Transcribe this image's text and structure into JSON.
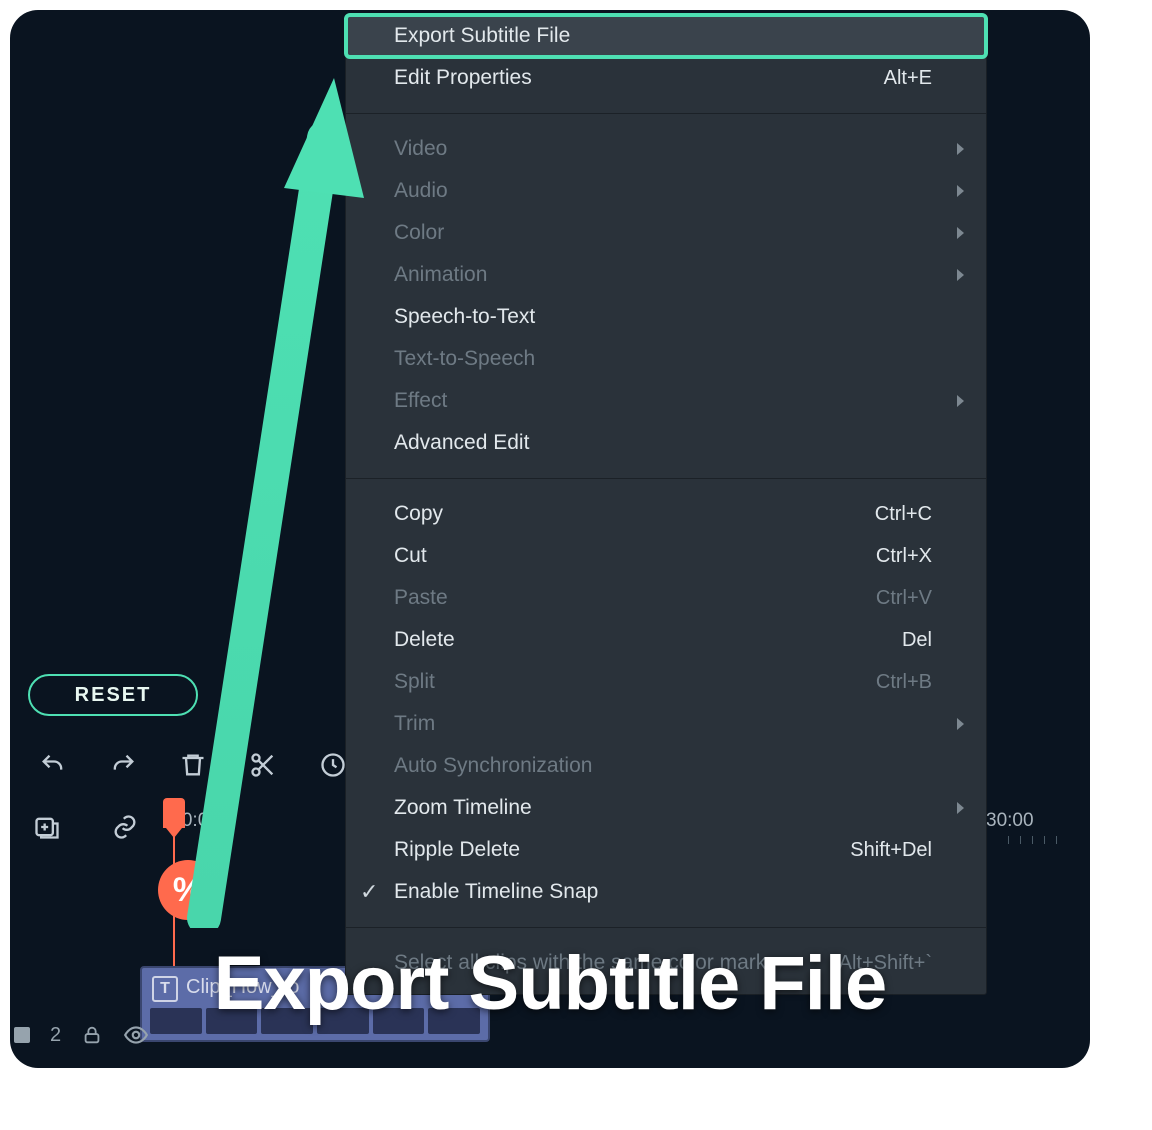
{
  "reset_label": "RESET",
  "ruler": {
    "label_left": ":00:0",
    "label_right": "30:00"
  },
  "clip": {
    "badge": "T",
    "name": "Clip_How_to"
  },
  "bottom_left": {
    "num": "2"
  },
  "caption": "Export Subtitle File",
  "marker_glyph": "%",
  "menu": {
    "groups": [
      [
        {
          "label": "Export Subtitle File",
          "shortcut": "",
          "disabled": false,
          "sub": false,
          "highlight": true,
          "check": false
        },
        {
          "label": "Edit Properties",
          "shortcut": "Alt+E",
          "disabled": false,
          "sub": false,
          "highlight": false,
          "check": false
        }
      ],
      [
        {
          "label": "Video",
          "shortcut": "",
          "disabled": true,
          "sub": true,
          "highlight": false,
          "check": false
        },
        {
          "label": "Audio",
          "shortcut": "",
          "disabled": true,
          "sub": true,
          "highlight": false,
          "check": false
        },
        {
          "label": "Color",
          "shortcut": "",
          "disabled": true,
          "sub": true,
          "highlight": false,
          "check": false
        },
        {
          "label": "Animation",
          "shortcut": "",
          "disabled": true,
          "sub": true,
          "highlight": false,
          "check": false
        },
        {
          "label": "Speech-to-Text",
          "shortcut": "",
          "disabled": false,
          "sub": false,
          "highlight": false,
          "check": false
        },
        {
          "label": "Text-to-Speech",
          "shortcut": "",
          "disabled": true,
          "sub": false,
          "highlight": false,
          "check": false
        },
        {
          "label": "Effect",
          "shortcut": "",
          "disabled": true,
          "sub": true,
          "highlight": false,
          "check": false
        },
        {
          "label": "Advanced Edit",
          "shortcut": "",
          "disabled": false,
          "sub": false,
          "highlight": false,
          "check": false
        }
      ],
      [
        {
          "label": "Copy",
          "shortcut": "Ctrl+C",
          "disabled": false,
          "sub": false,
          "highlight": false,
          "check": false
        },
        {
          "label": "Cut",
          "shortcut": "Ctrl+X",
          "disabled": false,
          "sub": false,
          "highlight": false,
          "check": false
        },
        {
          "label": "Paste",
          "shortcut": "Ctrl+V",
          "disabled": true,
          "sub": false,
          "highlight": false,
          "check": false
        },
        {
          "label": "Delete",
          "shortcut": "Del",
          "disabled": false,
          "sub": false,
          "highlight": false,
          "check": false
        },
        {
          "label": "Split",
          "shortcut": "Ctrl+B",
          "disabled": true,
          "sub": false,
          "highlight": false,
          "check": false
        },
        {
          "label": "Trim",
          "shortcut": "",
          "disabled": true,
          "sub": true,
          "highlight": false,
          "check": false
        },
        {
          "label": "Auto Synchronization",
          "shortcut": "",
          "disabled": true,
          "sub": false,
          "highlight": false,
          "check": false
        },
        {
          "label": "Zoom Timeline",
          "shortcut": "",
          "disabled": false,
          "sub": true,
          "highlight": false,
          "check": false
        },
        {
          "label": "Ripple Delete",
          "shortcut": "Shift+Del",
          "disabled": false,
          "sub": false,
          "highlight": false,
          "check": false
        },
        {
          "label": "Enable Timeline Snap",
          "shortcut": "",
          "disabled": false,
          "sub": false,
          "highlight": false,
          "check": true
        }
      ],
      [
        {
          "label": "Select all clips with the same color mark",
          "shortcut": "Alt+Shift+`",
          "disabled": true,
          "sub": false,
          "highlight": false,
          "check": false
        }
      ]
    ]
  }
}
